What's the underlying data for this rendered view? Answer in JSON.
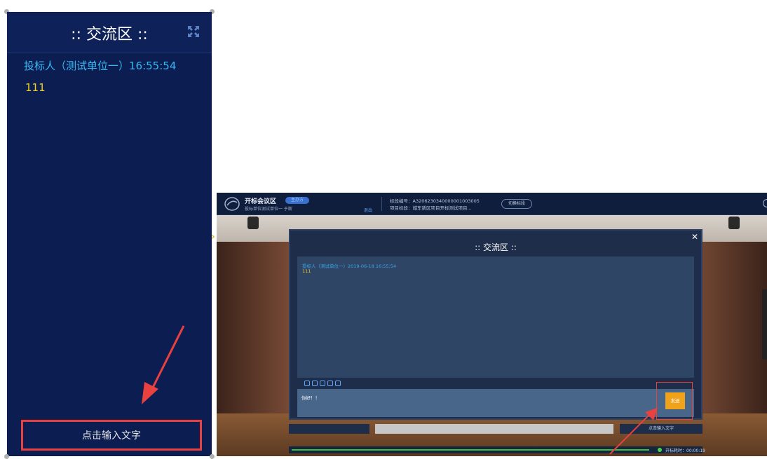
{
  "phone": {
    "title": ":: 交流区 ::",
    "message": {
      "sender": "投标人（测试单位一）16:55:54",
      "text": "111"
    },
    "input_placeholder": "点击输入文字"
  },
  "desktop": {
    "app_name": "开标会议区",
    "badge": "主办方",
    "user": "投标单位测试单位一  于斯",
    "exit": "退出",
    "project_no": "标段编号：A3206230340000001003005",
    "project_name": "项目标段：城东新区项目开标测试项目...",
    "switch_label": "切换标段",
    "chat": {
      "title": ":: 交流区 ::",
      "message": {
        "sender": "投标人（测试单位一）2019-06-18 16:55:54",
        "text": "111"
      },
      "input_value": "你好！！",
      "send_label": "发送"
    },
    "bottom_input_hint": "点击输入文字",
    "timer": "开标耗时：00:00:19"
  },
  "colors": {
    "accent_blue": "#35b9f2",
    "message_yellow": "#f2d21a",
    "highlight_red": "#e8413f",
    "send_orange": "#f0a21a"
  }
}
